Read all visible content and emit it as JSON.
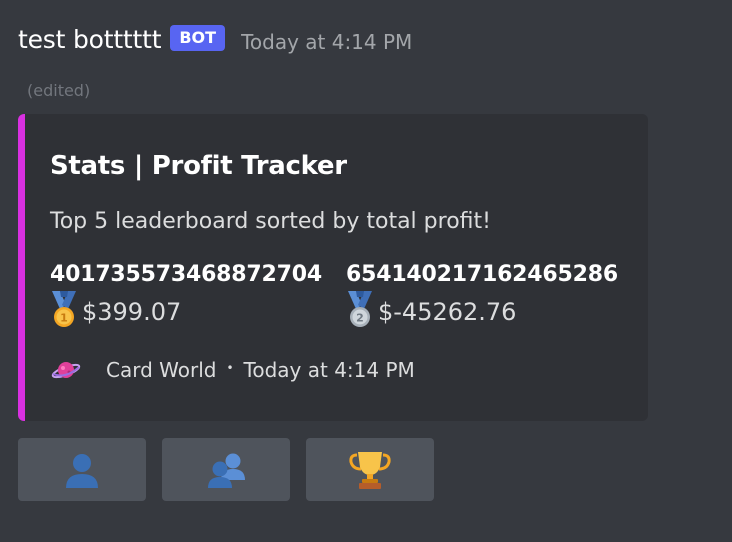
{
  "message": {
    "username": "test botttttt",
    "badge": "BOT",
    "timestamp": "Today at 4:14 PM",
    "edited": "(edited)"
  },
  "embed": {
    "accent_color": "#d930e1",
    "title": "Stats | Profit Tracker",
    "description": "Top 5 leaderboard sorted by total profit!",
    "fields": [
      {
        "name": "401735573468872704",
        "value": "$399.07",
        "icon": "first-place-medal-icon",
        "icon_text": "1"
      },
      {
        "name": "654140217162465286",
        "value": "$-45262.76",
        "icon": "second-place-medal-icon",
        "icon_text": "2"
      }
    ],
    "footer": {
      "icon": "card-world-planet-icon",
      "text": "Card World",
      "separator": "•",
      "timestamp": "Today at 4:14 PM"
    }
  },
  "buttons": [
    {
      "icon": "user-icon"
    },
    {
      "icon": "users-icon"
    },
    {
      "icon": "trophy-icon"
    }
  ]
}
